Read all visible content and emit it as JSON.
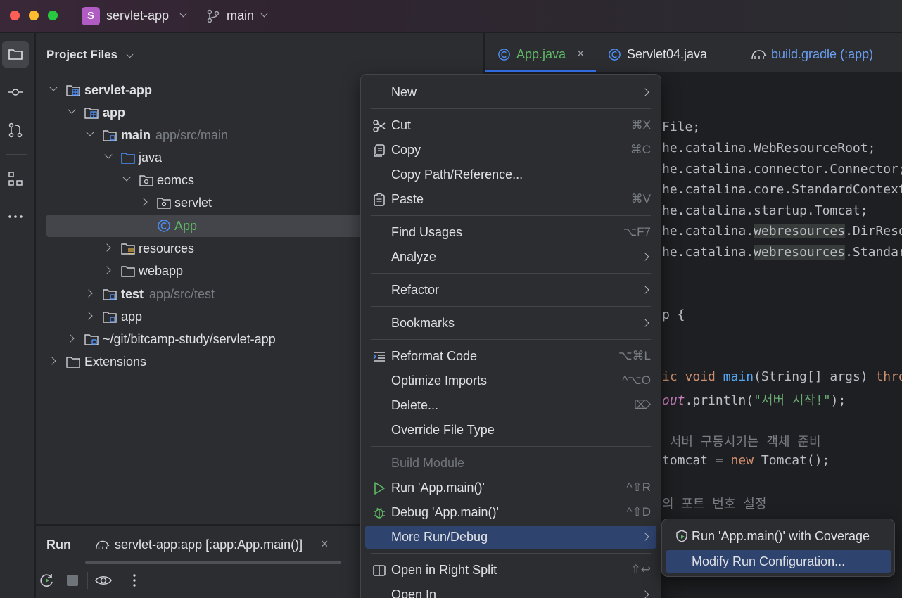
{
  "titlebar": {
    "project_initial": "S",
    "project_name": "servlet-app",
    "branch": "main"
  },
  "colors": {
    "accent": "#3574f0",
    "menu_highlight": "#2e436e",
    "project_badge": "#b05cc4",
    "class_icon": "#4f8ff7"
  },
  "toolstrip": {
    "items": [
      {
        "name": "project-icon",
        "active": true
      },
      {
        "name": "commit-icon"
      },
      {
        "name": "pull-requests-icon"
      },
      {
        "name": "structure-icon"
      },
      {
        "name": "more-icon"
      }
    ]
  },
  "project_panel": {
    "title": "Project Files",
    "tree": [
      {
        "label": "servlet-app",
        "hint": ""
      },
      {
        "label": "app",
        "hint": ""
      },
      {
        "label": "main",
        "hint": "app/src/main"
      },
      {
        "label": "java",
        "hint": ""
      },
      {
        "label": "eomcs",
        "hint": ""
      },
      {
        "label": "servlet",
        "hint": ""
      },
      {
        "label": "App",
        "hint": ""
      },
      {
        "label": "resources",
        "hint": ""
      },
      {
        "label": "webapp",
        "hint": ""
      },
      {
        "label": "test",
        "hint": "app/src/test"
      },
      {
        "label": "app",
        "hint": ""
      },
      {
        "label": "~/git/bitcamp-study/servlet-app",
        "hint": ""
      },
      {
        "label": "Extensions",
        "hint": ""
      }
    ]
  },
  "editor": {
    "tabs": [
      {
        "label": "App.java",
        "close": "×"
      },
      {
        "label": "Servlet04.java"
      },
      {
        "label": "build.gradle (:app)"
      }
    ],
    "code": {
      "l1": "File;",
      "l2": "he.catalina.WebResourceRoot;",
      "l3": "he.catalina.connector.Connector;",
      "l4": "he.catalina.core.StandardContext;",
      "l5": "he.catalina.startup.Tomcat;",
      "l6a": "he.catalina.",
      "l6b": "webresources",
      "l6c": ".DirResour",
      "l7a": "he.catalina.",
      "l7b": "webresources",
      "l7c": ".StandardR",
      "l8": "p {",
      "l9a": "ic ",
      "l9b": "void ",
      "l9c": "main",
      "l9d": "(String[] args) ",
      "l9e": "throws",
      "l10a": "out",
      "l10b": ".println(",
      "l10c": "\"서버 시작!\"",
      "l10d": ");",
      "l11": " 서버 구동시키는 객체 준비",
      "l12a": "tomcat = ",
      "l12b": "new ",
      "l12c": "Tomcat();",
      "l13": "의 포트 번호 설정"
    }
  },
  "run_panel": {
    "title": "Run",
    "tab_label": "servlet-app:app [:app:App.main()]",
    "close": "×"
  },
  "context_menu": {
    "items": {
      "new": {
        "label": "New"
      },
      "cut": {
        "label": "Cut",
        "shortcut": "⌘X"
      },
      "copy": {
        "label": "Copy",
        "shortcut": "⌘C"
      },
      "copy_path": {
        "label": "Copy Path/Reference..."
      },
      "paste": {
        "label": "Paste",
        "shortcut": "⌘V"
      },
      "find_usages": {
        "label": "Find Usages",
        "shortcut": "⌥F7"
      },
      "analyze": {
        "label": "Analyze"
      },
      "refactor": {
        "label": "Refactor"
      },
      "bookmarks": {
        "label": "Bookmarks"
      },
      "reformat": {
        "label": "Reformat Code",
        "shortcut": "⌥⌘L"
      },
      "optimize": {
        "label": "Optimize Imports",
        "shortcut": "^⌥O"
      },
      "delete": {
        "label": "Delete...",
        "shortcut": "⌦"
      },
      "override": {
        "label": "Override File Type"
      },
      "build_module": {
        "label": "Build Module"
      },
      "run": {
        "label": "Run 'App.main()'",
        "shortcut": "^⇧R"
      },
      "debug": {
        "label": "Debug 'App.main()'",
        "shortcut": "^⇧D"
      },
      "more_run": {
        "label": "More Run/Debug"
      },
      "open_right": {
        "label": "Open in Right Split",
        "shortcut": "⇧↩"
      },
      "open_in": {
        "label": "Open In"
      }
    }
  },
  "submenu": {
    "items": [
      {
        "label": "Run 'App.main()' with Coverage"
      },
      {
        "label": "Modify Run Configuration..."
      }
    ]
  }
}
